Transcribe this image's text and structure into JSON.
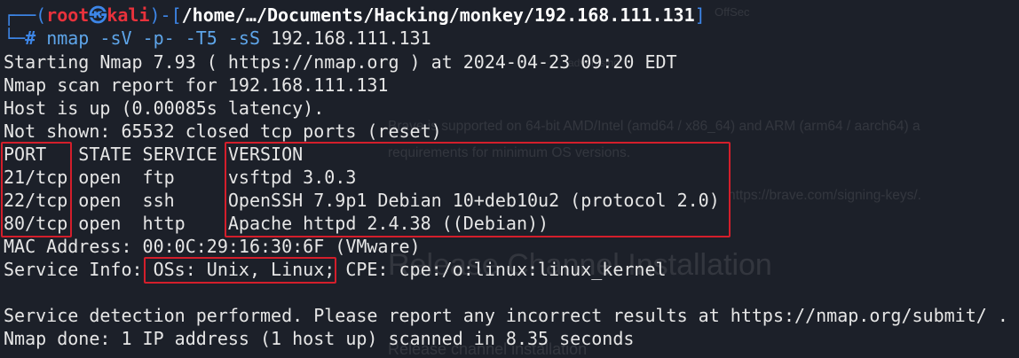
{
  "background_window": {
    "top_text_1": "OffSec",
    "top_text_2": "advertising",
    "para_1": "Brave is supported on 64-bit AMD/Intel (amd64 / x86_64) and ARM (arm64 / aarch64) a",
    "para_2": "requirements for minimum OS versions.",
    "para_3": "https://brave.com/signing-keys/.",
    "heading": "Release Channel Installation",
    "bottom": "Release channel installation"
  },
  "prompt": {
    "open": "┌──(",
    "user": "root",
    "skull": "㉿",
    "host": "kali",
    "close_open": ")-[",
    "path": "/home/…/Documents/Hacking/monkey/192.168.111.131",
    "close": "]",
    "line2_prefix": "└─",
    "hash": "#",
    "cmd_name": "nmap",
    "cmd_args": " -sV -p- -T5 -sS ",
    "cmd_target": "192.168.111.131"
  },
  "output": {
    "line_1": "Starting Nmap 7.93 ( https://nmap.org ) at 2024-04-23 09:20 EDT",
    "line_2": "Nmap scan report for 192.168.111.131",
    "line_3": "Host is up (0.00085s latency).",
    "line_4": "Not shown: 65532 closed tcp ports (reset)",
    "header": "PORT   STATE SERVICE VERSION",
    "rows": [
      "21/tcp open  ftp     vsftpd 3.0.3",
      "22/tcp open  ssh     OpenSSH 7.9p1 Debian 10+deb10u2 (protocol 2.0)",
      "80/tcp open  http    Apache httpd 2.4.38 ((Debian))"
    ],
    "mac": "MAC Address: 00:0C:29:16:30:6F (VMware)",
    "service_info": "Service Info: OSs: Unix, Linux; CPE: cpe:/o:linux:linux_kernel",
    "blank": "",
    "detection": "Service detection performed. Please report any incorrect results at https://nmap.org/submit/ .",
    "done": "Nmap done: 1 IP address (1 host up) scanned in 8.35 seconds"
  },
  "colors": {
    "background": "#1c2029",
    "prompt_blue": "#3d86e8",
    "prompt_red": "#e8323c",
    "highlight_red": "#d41e2b",
    "text": "#e6e6e6"
  }
}
